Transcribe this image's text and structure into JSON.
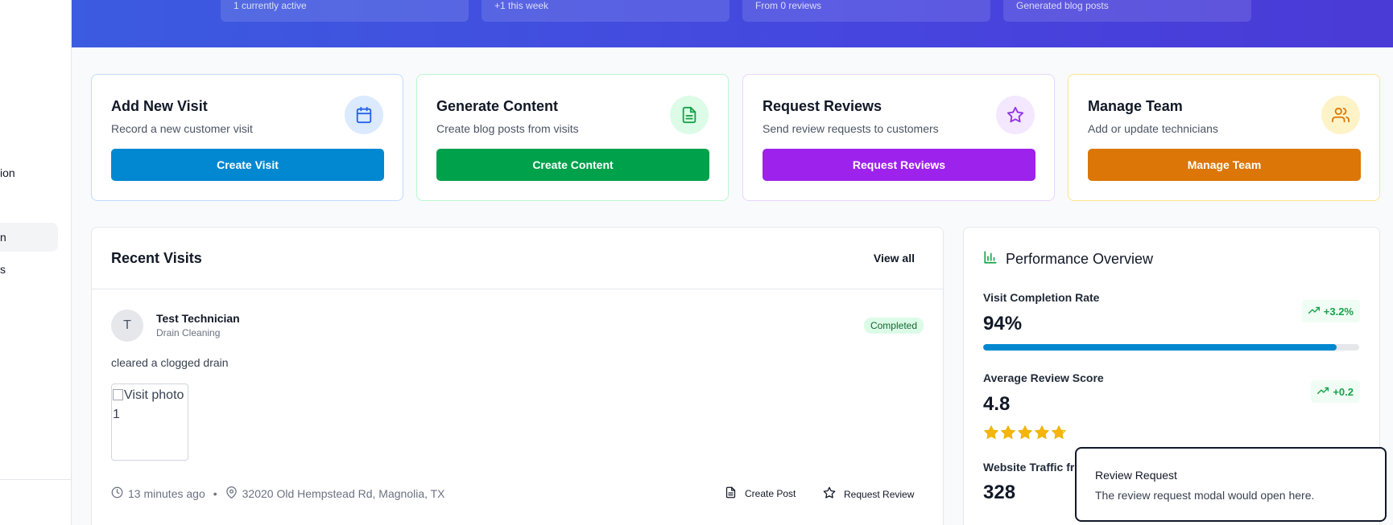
{
  "sidebar": {
    "items": [
      {
        "label": "ion"
      },
      {
        "label": "n"
      },
      {
        "label": "s"
      }
    ]
  },
  "hero": {
    "stats": [
      {
        "sub": "1 currently active"
      },
      {
        "sub": "+1 this week"
      },
      {
        "sub": "From 0 reviews"
      },
      {
        "sub": "Generated blog posts"
      }
    ]
  },
  "actions": [
    {
      "title": "Add New Visit",
      "description": "Record a new customer visit",
      "button": "Create Visit",
      "icon": "calendar-icon",
      "color": "#0288d1",
      "tint": "#dbeafe",
      "border": "#bfdbfe"
    },
    {
      "title": "Generate Content",
      "description": "Create blog posts from visits",
      "button": "Create Content",
      "icon": "document-icon",
      "color": "#00a14b",
      "tint": "#dcfce7",
      "border": "#bbf7d0"
    },
    {
      "title": "Request Reviews",
      "description": "Send review requests to customers",
      "button": "Request Reviews",
      "icon": "star-icon",
      "color": "#9d22ec",
      "tint": "#f3e8ff",
      "border": "#e9d5ff"
    },
    {
      "title": "Manage Team",
      "description": "Add or update technicians",
      "button": "Manage Team",
      "icon": "users-icon",
      "color": "#dc7606",
      "tint": "#fef3c7",
      "border": "#fde68a"
    }
  ],
  "recent_visits": {
    "title": "Recent Visits",
    "view_all": "View all",
    "visit": {
      "initial": "T",
      "technician": "Test Technician",
      "service": "Drain Cleaning",
      "status": "Completed",
      "notes": "cleared a clogged drain",
      "photo_alt": "Visit photo 1",
      "time": "13 minutes ago",
      "separator": "•",
      "address": "32020 Old Hempstead Rd, Magnolia, TX",
      "create_post": "Create Post",
      "request_review": "Request Review"
    }
  },
  "performance": {
    "title": "Performance Overview",
    "completion": {
      "label": "Visit Completion Rate",
      "value": "94%",
      "trend": "+3.2%",
      "progress": 0.94
    },
    "review": {
      "label": "Average Review Score",
      "value": "4.8",
      "trend": "+0.2",
      "stars": 4.8
    },
    "traffic": {
      "label": "Website Traffic fro",
      "value": "328"
    }
  },
  "toast": {
    "title": "Review Request",
    "message": "The review request modal would open here."
  },
  "colors": {
    "hero": "#4646de",
    "star": "#f5b50a",
    "trend_green": "#16a34a"
  }
}
